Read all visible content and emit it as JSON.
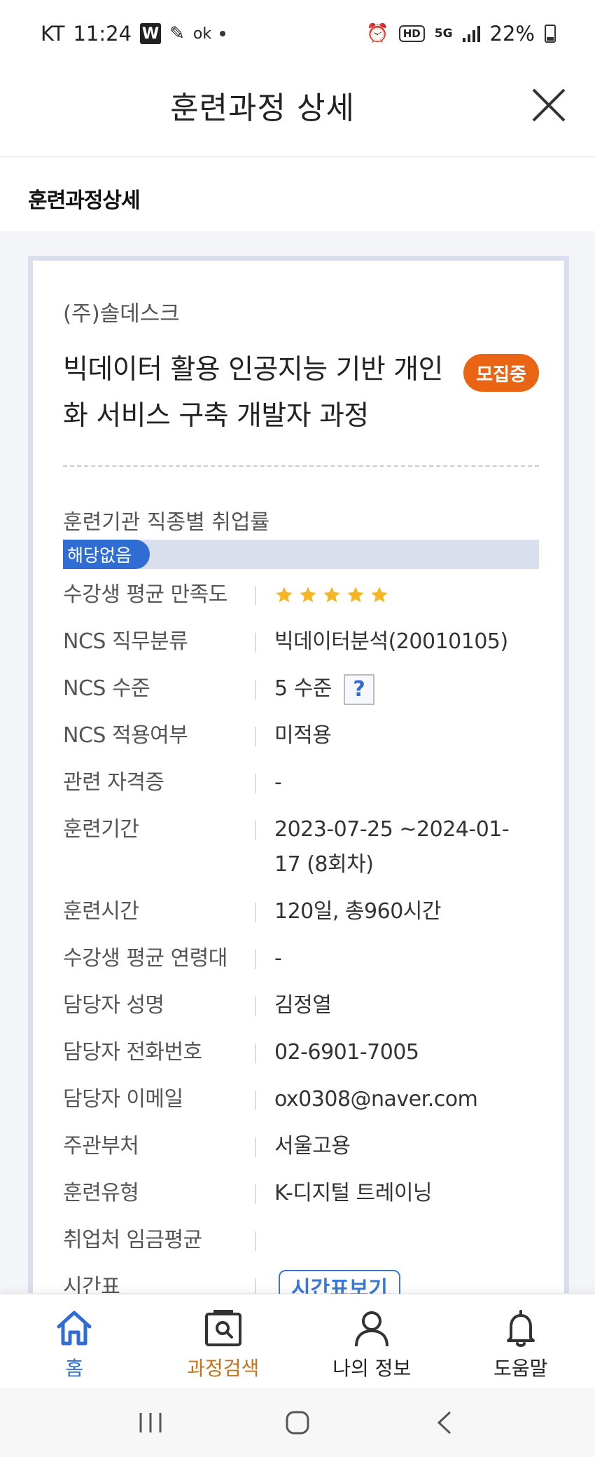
{
  "status_bar": {
    "carrier": "KT",
    "time": "11:24",
    "app_w": "W",
    "ok": "ok",
    "hd": "HD",
    "net": "5G",
    "battery": "22%"
  },
  "header": {
    "title": "훈련과정 상세"
  },
  "subhead": {
    "title": "훈련과정상세"
  },
  "course": {
    "org": "(주)솔데스크",
    "title": "빅데이터 활용 인공지능 기반 개인화 서비스 구축 개발자 과정",
    "badge": "모집중",
    "employment_label": "훈련기관 직종별 취업률",
    "employment_value": "해당없음"
  },
  "info": {
    "satisfaction": {
      "label": "수강생 평균 만족도",
      "stars": 5
    },
    "ncs_class": {
      "label": "NCS 직무분류",
      "value": "빅데이터분석(20010105)"
    },
    "ncs_level": {
      "label": "NCS 수준",
      "value": "5 수준",
      "help": "?"
    },
    "ncs_applied": {
      "label": "NCS 적용여부",
      "value": "미적용"
    },
    "cert": {
      "label": "관련 자격증",
      "value": "-"
    },
    "period": {
      "label": "훈련기간",
      "value": "2023-07-25 ~2024-01-17 (8회차)"
    },
    "hours": {
      "label": "훈련시간",
      "value": "120일, 총960시간"
    },
    "age": {
      "label": "수강생 평균 연령대",
      "value": "-"
    },
    "manager": {
      "label": "담당자 성명",
      "value": "김정열"
    },
    "phone": {
      "label": "담당자 전화번호",
      "value": "02-6901-7005"
    },
    "email": {
      "label": "담당자 이메일",
      "value": "ox0308@naver.com"
    },
    "dept": {
      "label": "주관부처",
      "value": "서울고용"
    },
    "type": {
      "label": "훈련유형",
      "value": "K-디지털 트레이닝"
    },
    "wage": {
      "label": "취업처 임금평균",
      "value": ""
    },
    "timetable": {
      "label": "시간표",
      "button": "시간표보기"
    }
  },
  "nav": {
    "home": "홈",
    "search": "과정검색",
    "profile": "나의 정보",
    "help": "도움말"
  },
  "colors": {
    "accent": "#2f6dd4",
    "badge": "#ea6513",
    "star": "#f5b623",
    "search": "#c4731b"
  }
}
